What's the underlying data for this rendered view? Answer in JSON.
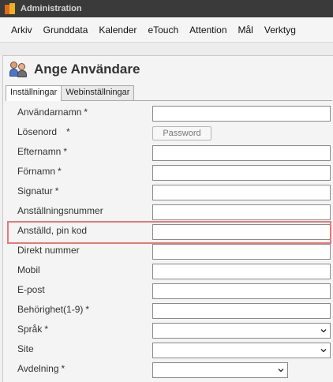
{
  "window": {
    "title": "Administration"
  },
  "menu": [
    "Arkiv",
    "Grunddata",
    "Kalender",
    "eTouch",
    "Attention",
    "Mål",
    "Verktyg"
  ],
  "panel": {
    "title": "Ange Användare"
  },
  "tabs": [
    "Inställningar",
    "Webinställningar"
  ],
  "active_tab": "Inställningar",
  "form": {
    "rows": [
      {
        "label": "Användarnamn",
        "required": "*",
        "type": "text",
        "value": ""
      },
      {
        "label": "Lösenord",
        "required": "*",
        "type": "password-button",
        "button_label": "Password"
      },
      {
        "label": "Efternamn",
        "required": "*",
        "type": "text",
        "value": ""
      },
      {
        "label": "Förnamn",
        "required": "*",
        "type": "text",
        "value": ""
      },
      {
        "label": "Signatur",
        "required": "*",
        "type": "text",
        "value": ""
      },
      {
        "label": "Anställningsnummer",
        "required": "",
        "type": "text",
        "value": ""
      },
      {
        "label": "Anställd, pin kod",
        "required": "",
        "type": "text",
        "value": "",
        "highlighted": true
      },
      {
        "label": "Direkt nummer",
        "required": "",
        "type": "text",
        "value": ""
      },
      {
        "label": "Mobil",
        "required": "",
        "type": "text",
        "value": ""
      },
      {
        "label": "E-post",
        "required": "",
        "type": "text",
        "value": ""
      },
      {
        "label": "Behörighet(1-9)",
        "required": "*",
        "type": "text",
        "value": ""
      },
      {
        "label": "Språk",
        "required": "*",
        "type": "select",
        "value": ""
      },
      {
        "label": "Site",
        "required": "",
        "type": "select",
        "value": ""
      },
      {
        "label": "Avdelning",
        "required": "*",
        "type": "select",
        "value": ""
      }
    ]
  },
  "colors": {
    "highlight": "#e87878",
    "titlebar": "#3a3a3a"
  },
  "icons": {
    "app": "app-logo-icon",
    "panel": "users-icon",
    "dropdown": "chevron-down-icon"
  }
}
